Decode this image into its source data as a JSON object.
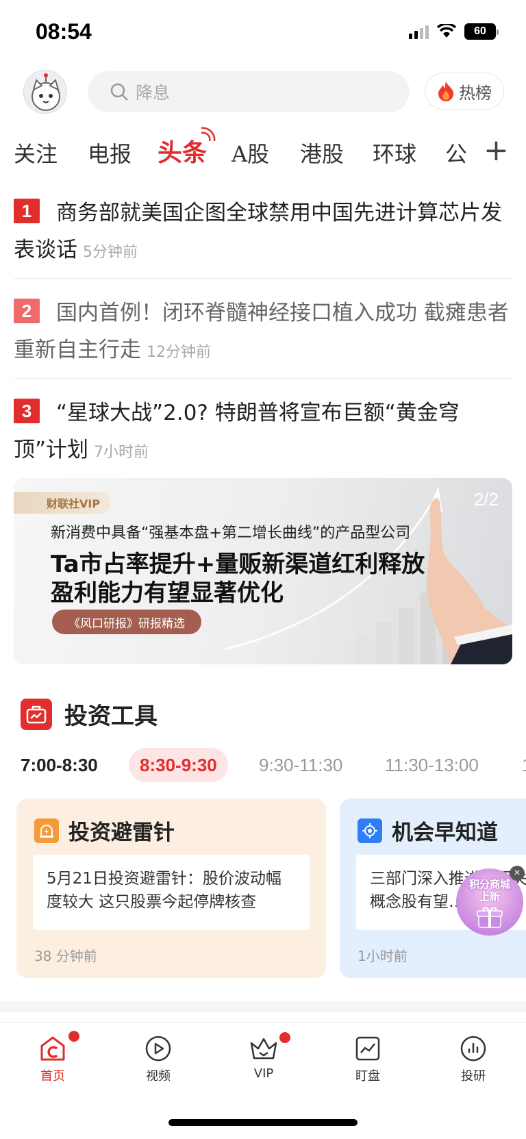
{
  "status_bar": {
    "time": "08:54",
    "battery": "60"
  },
  "header": {
    "search_placeholder": "降息",
    "hot_label": "热榜"
  },
  "tabs": [
    "关注",
    "电报",
    "头条",
    "A股",
    "港股",
    "环球",
    "公"
  ],
  "active_tab": "头条",
  "headlines": [
    {
      "rank": "1",
      "title": "商务部就美国企图全球禁用中国先进计算芯片发表谈话",
      "time": "5分钟前"
    },
    {
      "rank": "2",
      "title": "国内首例！闭环脊髓神经接口植入成功 截瘫患者重新自主行走",
      "time": "12分钟前"
    },
    {
      "rank": "3",
      "title": "“星球大战”2.0? 特朗普将宣布巨额“黄金穹顶”计划",
      "time": "7小时前"
    }
  ],
  "banner": {
    "badge": "财联社VIP",
    "counter": "2/2",
    "line1": "新消费中具备“强基本盘+第二增长曲线”的产品型公司",
    "line2": "Ta市占率提升+量贩新渠道红利释放",
    "line3": "盈利能力有望显著优化",
    "tag": "《风口研报》研报精选"
  },
  "tools": {
    "title": "投资工具",
    "time_tabs": [
      "7:00-8:30",
      "8:30-9:30",
      "9:30-11:30",
      "11:30-13:00",
      "1"
    ],
    "active_time_tab": "8:30-9:30",
    "cards": [
      {
        "title": "投资避雷针",
        "body": "5月21日投资避雷针：股价波动幅度较大 这只股票今起停牌核查",
        "time": "38 分钟前"
      },
      {
        "title": "机会早知道",
        "body": "三部门深入推进…相关概念股有望…",
        "time": "1小时前"
      }
    ]
  },
  "promo": {
    "line1": "积分商城",
    "line2": "上新",
    "close": "×"
  },
  "bottom_nav": [
    {
      "label": "首页",
      "active": true,
      "dot": true
    },
    {
      "label": "视频",
      "active": false,
      "dot": false
    },
    {
      "label": "VIP",
      "active": false,
      "dot": true
    },
    {
      "label": "盯盘",
      "active": false,
      "dot": false
    },
    {
      "label": "投研",
      "active": false,
      "dot": false
    }
  ],
  "colors": {
    "accent": "#e22d2d",
    "orange_card": "#fdeee2",
    "blue_card": "#e3effd"
  }
}
